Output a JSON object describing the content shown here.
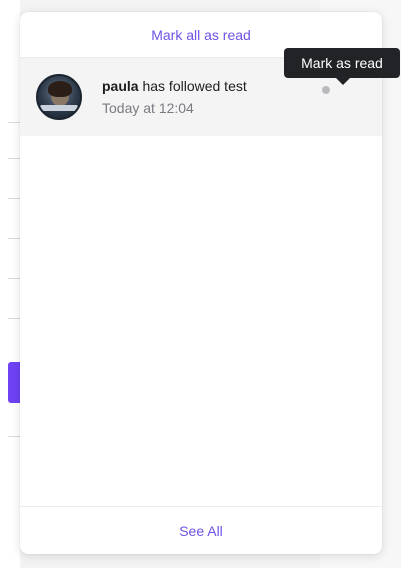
{
  "dropdown": {
    "mark_all_label": "Mark all as read",
    "see_all_label": "See All"
  },
  "notifications": [
    {
      "user": "paula",
      "action": "has followed test",
      "time": "Today at 12:04",
      "read": false
    }
  ],
  "tooltip": {
    "text": "Mark as read"
  },
  "colors": {
    "accent": "#6f52e6",
    "tooltip_bg": "#222326",
    "unread_dot": "#b9b9be",
    "background_accent": "#6e42f5"
  }
}
